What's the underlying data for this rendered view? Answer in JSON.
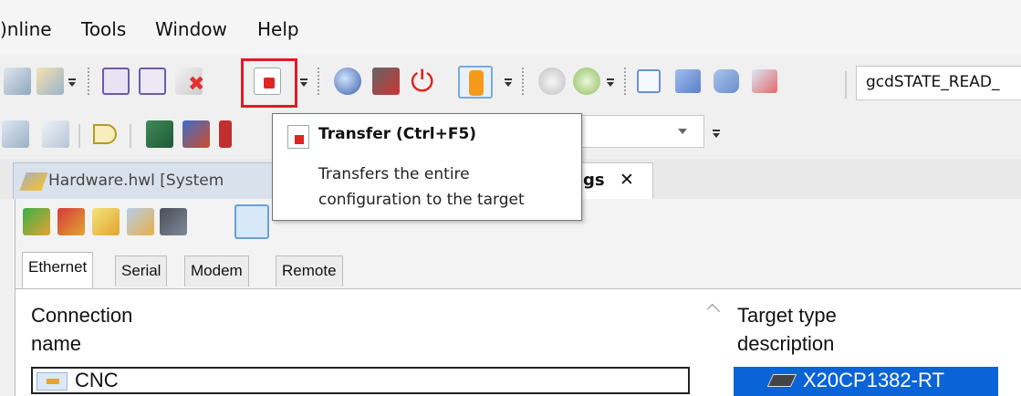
{
  "menu": {
    "items": [
      "Online",
      "Tools",
      "Window",
      "Help"
    ],
    "online_visible": ")nline"
  },
  "toolbar": {
    "state_text": "gcdSTATE_READ_",
    "transfer_button_icon": "transfer-icon"
  },
  "tooltip": {
    "title": "Transfer  (Ctrl+F5)",
    "body_line1": "Transfers the entire",
    "body_line2": "configuration to the target"
  },
  "tabs": {
    "hardware_label": "Hardware.hwl [System",
    "settings_partial": "gs",
    "close_glyph": "✕"
  },
  "subtabs": [
    "Ethernet",
    "Serial",
    "Modem",
    "Remote"
  ],
  "columns": {
    "connection_line1": "Connection",
    "connection_line2": "name",
    "target_line1": "Target type",
    "target_line2": "description"
  },
  "rows": {
    "connection_value": "CNC",
    "target_value": "X20CP1382-RT"
  },
  "colors": {
    "highlight": "#e01b24",
    "selection": "#0a64d8"
  }
}
